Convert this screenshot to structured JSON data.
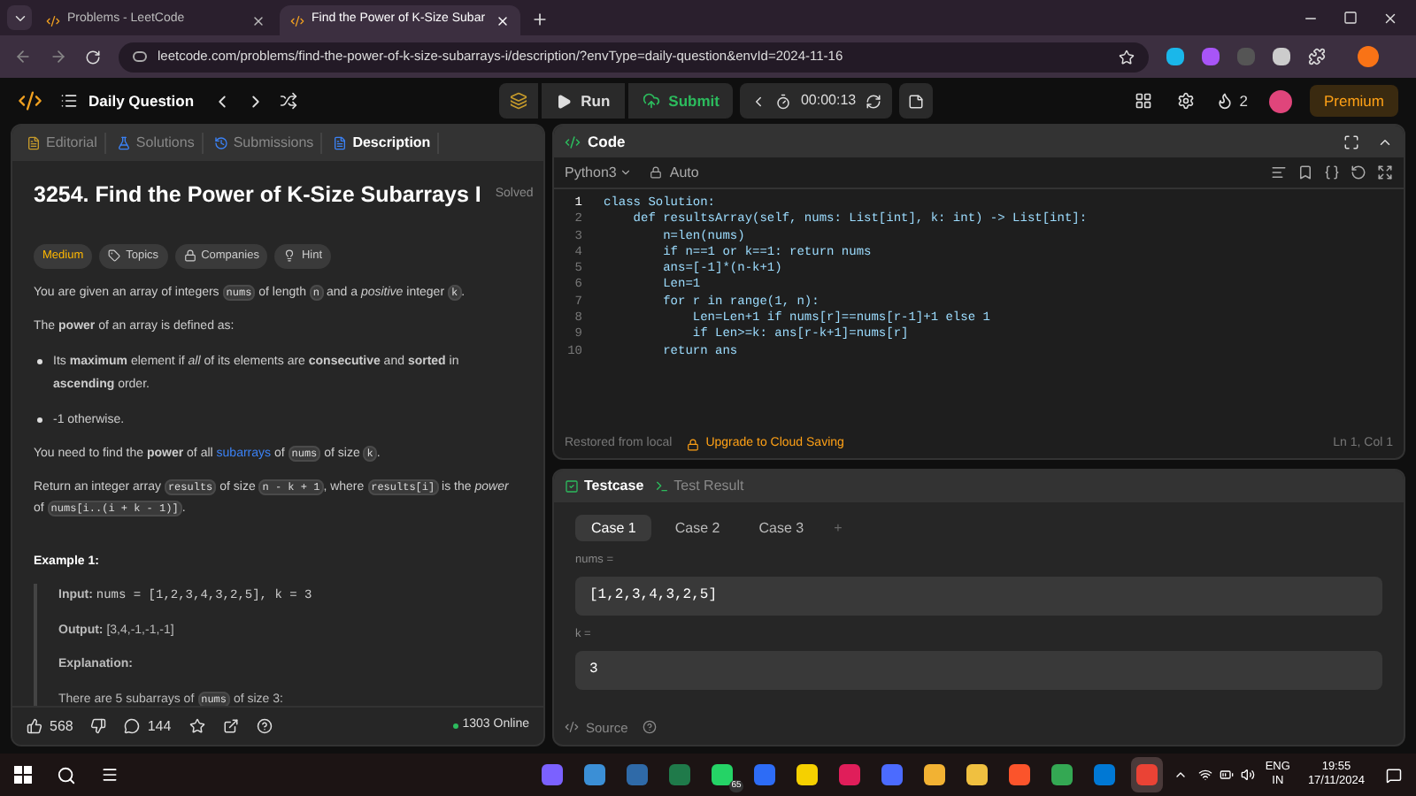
{
  "browser": {
    "tabs": [
      {
        "label": "Problems - LeetCode",
        "selected": false
      },
      {
        "label": "Find the Power of K-Size Subar",
        "selected": true
      }
    ],
    "url": "leetcode.com/problems/find-the-power-of-k-size-subarrays-i/description/?envType=daily-question&envId=2024-11-16"
  },
  "topbar": {
    "title": "Daily Question",
    "run": "Run",
    "submit": "Submit",
    "timer": "00:00:13",
    "streak": "2",
    "premium": "Premium"
  },
  "left_panel": {
    "tabs": [
      {
        "label": "Editorial",
        "selected": false
      },
      {
        "label": "Solutions",
        "selected": false
      },
      {
        "label": "Submissions",
        "selected": false
      },
      {
        "label": "Description",
        "selected": true
      }
    ],
    "title": "3254. Find the Power of K-Size Subarrays I",
    "status": "Solved",
    "tags": [
      {
        "kind": "difficulty",
        "label": "Medium"
      },
      {
        "kind": "topics",
        "label": "Topics"
      },
      {
        "kind": "companies",
        "label": "Companies"
      },
      {
        "kind": "hint",
        "label": "Hint"
      }
    ],
    "blocks": [
      {
        "kind": "para",
        "parts": [
          {
            "kind": "text",
            "text": "You are given an array of integers "
          },
          {
            "kind": "code",
            "text": "nums"
          },
          {
            "kind": "text",
            "text": " of length "
          },
          {
            "kind": "code",
            "text": "n"
          },
          {
            "kind": "text",
            "text": " and a *positive* integer "
          },
          {
            "kind": "code",
            "text": "k"
          },
          {
            "kind": "text",
            "text": "."
          }
        ]
      },
      {
        "kind": "para",
        "parts": [
          {
            "kind": "text",
            "text": "The **power** of an array is defined as:"
          }
        ]
      },
      {
        "kind": "bullet",
        "parts": [
          {
            "kind": "text",
            "text": "Its **maximum** element if *all* of its elements are **consecutive** and **sorted** in **ascending** order."
          }
        ]
      },
      {
        "kind": "bullet",
        "parts": [
          {
            "kind": "text",
            "text": "-1 otherwise."
          }
        ]
      },
      {
        "kind": "para",
        "parts": [
          {
            "kind": "text",
            "text": "You need to find the **power** of all "
          },
          {
            "kind": "link",
            "text": "subarrays"
          },
          {
            "kind": "text",
            "text": " of "
          },
          {
            "kind": "code",
            "text": "nums"
          },
          {
            "kind": "text",
            "text": " of size "
          },
          {
            "kind": "code",
            "text": "k"
          },
          {
            "kind": "text",
            "text": "."
          }
        ]
      },
      {
        "kind": "para",
        "parts": [
          {
            "kind": "text",
            "text": "Return an integer array "
          },
          {
            "kind": "code",
            "text": "results"
          },
          {
            "kind": "text",
            "text": " of size "
          },
          {
            "kind": "code",
            "text": "n - k + 1"
          },
          {
            "kind": "text",
            "text": ", where "
          },
          {
            "kind": "code",
            "text": "results[i]"
          },
          {
            "kind": "text",
            "text": " is the *power* of "
          },
          {
            "kind": "code",
            "text": "nums[i..(i + k - 1)]"
          },
          {
            "kind": "text",
            "text": "."
          }
        ]
      },
      {
        "kind": "heading",
        "text": "Example 1:"
      },
      {
        "kind": "example",
        "lines": [
          {
            "parts": [
              {
                "kind": "text",
                "text": "**Input:** "
              },
              {
                "kind": "mono",
                "text": "nums = [1,2,3,4,3,2,5], k = 3"
              }
            ]
          },
          {
            "parts": [
              {
                "kind": "text",
                "text": "**Output:** [3,4,-1,-1,-1]"
              }
            ]
          },
          {
            "parts": [
              {
                "kind": "text",
                "text": "**Explanation:**"
              }
            ]
          },
          {
            "parts": [
              {
                "kind": "text",
                "text": "There are 5 subarrays of "
              },
              {
                "kind": "code",
                "text": "nums"
              },
              {
                "kind": "text",
                "text": " of size 3:"
              }
            ]
          }
        ]
      }
    ],
    "footer": {
      "likes": "568",
      "comments": "144",
      "online": "1303 Online"
    }
  },
  "code_panel": {
    "title": "Code",
    "language": "Python3",
    "mode": "Auto",
    "lines": [
      {
        "number": "1",
        "code": "class Solution:"
      },
      {
        "number": "2",
        "code": "    def resultsArray(self, nums: List[int], k: int) -> List[int]:"
      },
      {
        "number": "3",
        "code": "        n=len(nums)"
      },
      {
        "number": "4",
        "code": "        if n==1 or k==1: return nums"
      },
      {
        "number": "5",
        "code": "        ans=[-1]*(n-k+1)"
      },
      {
        "number": "6",
        "code": "        Len=1"
      },
      {
        "number": "7",
        "code": "        for r in range(1, n):"
      },
      {
        "number": "8",
        "code": "            Len=Len+1 if nums[r]==nums[r-1]+1 else 1"
      },
      {
        "number": "9",
        "code": "            if Len>=k: ans[r-k+1]=nums[r]"
      },
      {
        "number": "10",
        "code": "        return ans"
      }
    ],
    "status": "Restored from local",
    "upgrade": "Upgrade to Cloud Saving",
    "cursor": "Ln 1, Col 1"
  },
  "test_panel": {
    "tabs": [
      {
        "label": "Testcase",
        "selected": true
      },
      {
        "label": "Test Result",
        "selected": false
      }
    ],
    "cases": [
      {
        "label": "Case 1",
        "selected": true
      },
      {
        "label": "Case 2",
        "selected": false
      },
      {
        "label": "Case 3",
        "selected": false
      }
    ],
    "add": "+",
    "fields": [
      {
        "label": "nums =",
        "value": "[1,2,3,4,3,2,5]"
      },
      {
        "label": "k =",
        "value": "3"
      }
    ],
    "source": "Source"
  },
  "taskbar": {
    "apps": [
      {
        "color": "#7b61ff",
        "selected": false
      },
      {
        "color": "#3b8fd6",
        "selected": false
      },
      {
        "color": "#2f6aa8",
        "selected": false
      },
      {
        "color": "#1f7a4a",
        "selected": false
      },
      {
        "color": "#25d366",
        "selected": false,
        "badge": "65"
      },
      {
        "color": "#2d6cf6",
        "selected": false
      },
      {
        "color": "#f5d000",
        "selected": false
      },
      {
        "color": "#e01e5a",
        "selected": false
      },
      {
        "color": "#4b6bff",
        "selected": false
      },
      {
        "color": "#f2b233",
        "selected": false
      },
      {
        "color": "#f0c040",
        "selected": false
      },
      {
        "color": "#fb542b",
        "selected": false
      },
      {
        "color": "#34a853",
        "selected": false
      },
      {
        "color": "#0078d4",
        "selected": false
      },
      {
        "color": "#ea4335",
        "selected": true
      }
    ],
    "language": "ENG",
    "region": "IN",
    "time": "19:55",
    "date": "17/11/2024"
  }
}
